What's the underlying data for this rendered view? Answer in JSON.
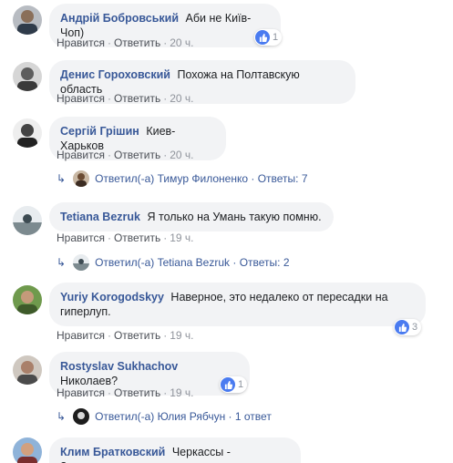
{
  "comments": [
    {
      "author": "Андрій Бобровський",
      "text": "Аби не Київ-Чоп)",
      "like_label": "Нравится",
      "reply_label": "Ответить",
      "time": "20 ч.",
      "reactions": "1"
    },
    {
      "author": "Денис Гороховский",
      "text": "Похожа на Полтавскую область",
      "like_label": "Нравится",
      "reply_label": "Ответить",
      "time": "20 ч."
    },
    {
      "author": "Сергій Грішин",
      "text": "Киев-Харьков",
      "like_label": "Нравится",
      "reply_label": "Ответить",
      "time": "20 ч.",
      "replies": {
        "answered_label": "Ответил(-а)",
        "name": "Тимур Филоненко",
        "sep": "·",
        "count": "Ответы: 7"
      }
    },
    {
      "author": "Tetiana Bezruk",
      "text": "Я только на Умань такую помню.",
      "like_label": "Нравится",
      "reply_label": "Ответить",
      "time": "19 ч.",
      "replies": {
        "answered_label": "Ответил(-а)",
        "name": "Tetiana Bezruk",
        "sep": "·",
        "count": "Ответы: 2"
      }
    },
    {
      "author": "Yuriy Korogodskyy",
      "text_line1": "Наверное, это недалеко от пересадки на",
      "text_line2": "гиперлуп.",
      "like_label": "Нравится",
      "reply_label": "Ответить",
      "time": "19 ч.",
      "reactions": "3"
    },
    {
      "author": "Rostyslav Sukhachov",
      "text": "Николаев?",
      "like_label": "Нравится",
      "reply_label": "Ответить",
      "time": "19 ч.",
      "reactions": "1",
      "replies": {
        "answered_label": "Ответил(-а)",
        "name": "Юлия Рябчун",
        "sep": "·",
        "count": "1 ответ"
      }
    },
    {
      "author": "Клим Братковский",
      "text": "Черкассы - Запорожье"
    }
  ],
  "colors": {
    "link": "#385898",
    "bubble": "#f2f3f5",
    "meta": "#90949c",
    "like": "#4a7bf0"
  }
}
